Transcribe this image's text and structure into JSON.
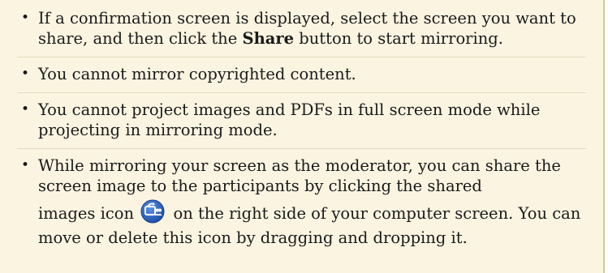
{
  "notes": {
    "item1": {
      "text_before": "If a confirmation screen is displayed, select the screen you want to share, and then click the ",
      "bold": "Share",
      "text_after": " button to start mirroring."
    },
    "item2": {
      "text": "You cannot mirror copyrighted content."
    },
    "item3": {
      "text": "You cannot project images and PDFs in full screen mode while projecting in mirroring mode."
    },
    "item4": {
      "text_before": "While mirroring your screen as the moderator, you can share the screen image to the participants by clicking the shared",
      "text_icon_prefix": "images icon",
      "icon": "shared-images-icon",
      "text_after": "on the right side of your computer screen. You can move or delete this icon by dragging and dropping it."
    }
  },
  "colors": {
    "background": "#fbf4e1",
    "icon_blue": "#2b63c4"
  }
}
